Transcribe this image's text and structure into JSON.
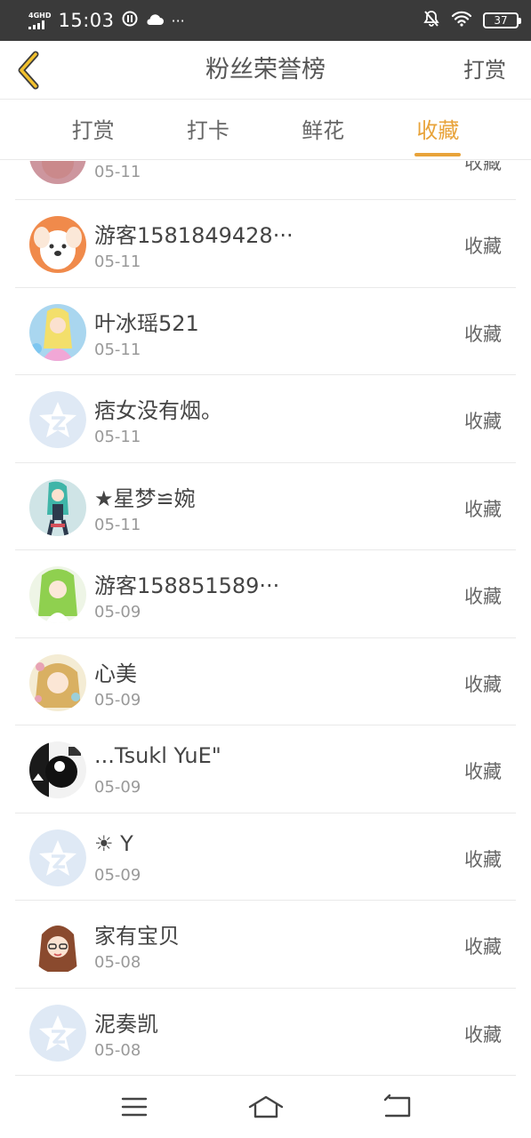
{
  "status_bar": {
    "network": "4GHD",
    "time": "15:03",
    "battery": "37",
    "extra": "···"
  },
  "header": {
    "title": "粉丝荣誉榜",
    "right_button": "打赏"
  },
  "tabs": [
    {
      "label": "打赏",
      "active": false
    },
    {
      "label": "打卡",
      "active": false
    },
    {
      "label": "鲜花",
      "active": false
    },
    {
      "label": "收藏",
      "active": true
    }
  ],
  "fans": [
    {
      "name": "",
      "date": "05-11",
      "action": "收藏",
      "avatar": "anime-girl"
    },
    {
      "name": "游客1581849428···",
      "date": "05-11",
      "action": "收藏",
      "avatar": "puppy"
    },
    {
      "name": "叶冰瑶521",
      "date": "05-11",
      "action": "收藏",
      "avatar": "anime-girl"
    },
    {
      "name": "痞女没有烟。",
      "date": "05-11",
      "action": "收藏",
      "avatar": "default-star"
    },
    {
      "name": "★星梦≌婉",
      "date": "05-11",
      "action": "收藏",
      "avatar": "anime-girl"
    },
    {
      "name": "游客158851589···",
      "date": "05-09",
      "action": "收藏",
      "avatar": "anime-girl"
    },
    {
      "name": "心美",
      "date": "05-09",
      "action": "收藏",
      "avatar": "anime-girl"
    },
    {
      "name": "...Tsukl YuE\"",
      "date": "05-09",
      "action": "收藏",
      "avatar": "photo-bw"
    },
    {
      "name": "☀ Y",
      "date": "05-09",
      "action": "收藏",
      "avatar": "default-star"
    },
    {
      "name": "家有宝贝",
      "date": "05-08",
      "action": "收藏",
      "avatar": "girl-glasses"
    },
    {
      "name": "泥奏凯",
      "date": "05-08",
      "action": "收藏",
      "avatar": "default-star"
    }
  ],
  "colors": {
    "accent": "#e8a33a",
    "status_bar": "#3a3a3a",
    "default_avatar": "#dfe9f5"
  }
}
